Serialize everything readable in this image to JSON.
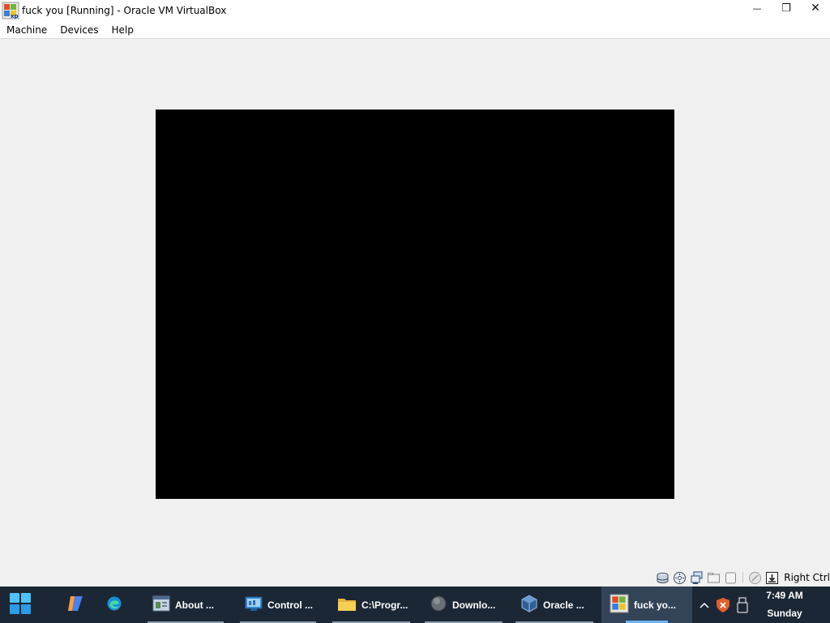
{
  "window": {
    "title": "fuck you [Running] - Oracle VM VirtualBox",
    "icon": "windows-xp-vm-icon",
    "controls": [
      "minimize-icon",
      "restore-icon",
      "close-icon"
    ],
    "minimize_glyph": "—",
    "restore_glyph": "❐",
    "close_glyph": "✕"
  },
  "menubar": {
    "items": [
      "Machine",
      "Devices",
      "Help"
    ]
  },
  "vm": {
    "screen_color": "#000000"
  },
  "statusbar": {
    "icons": [
      "hard-disk-icon",
      "optical-drive-icon",
      "network-icon",
      "shared-folders-icon",
      "display-icon",
      "mouse-integration-icon",
      "keyboard-capture-icon"
    ],
    "host_key": "Right Ctrl"
  },
  "taskbar": {
    "pinned": [
      "start-icon",
      "copilot-icon",
      "edge-icon"
    ],
    "tasks": [
      {
        "label": "About ...",
        "icon": "about-window-icon"
      },
      {
        "label": "Control ...",
        "icon": "control-panel-icon"
      },
      {
        "label": "C:\\Progr...",
        "icon": "folder-icon"
      },
      {
        "label": "Downlo...",
        "icon": "download-icon"
      },
      {
        "label": "Oracle ...",
        "icon": "virtualbox-icon"
      },
      {
        "label": "fuck yo...",
        "icon": "windows-xp-vm-icon"
      }
    ],
    "tray": {
      "icons": [
        "show-hidden-icons-chevron",
        "security-shield-icon",
        "usb-device-icon"
      ],
      "time": "7:49 AM",
      "day": "Sunday"
    }
  },
  "colors": {
    "taskbar_bg": "#1c2735",
    "active_task_bg": "#344458",
    "active_indicator": "#6cb4f0"
  }
}
